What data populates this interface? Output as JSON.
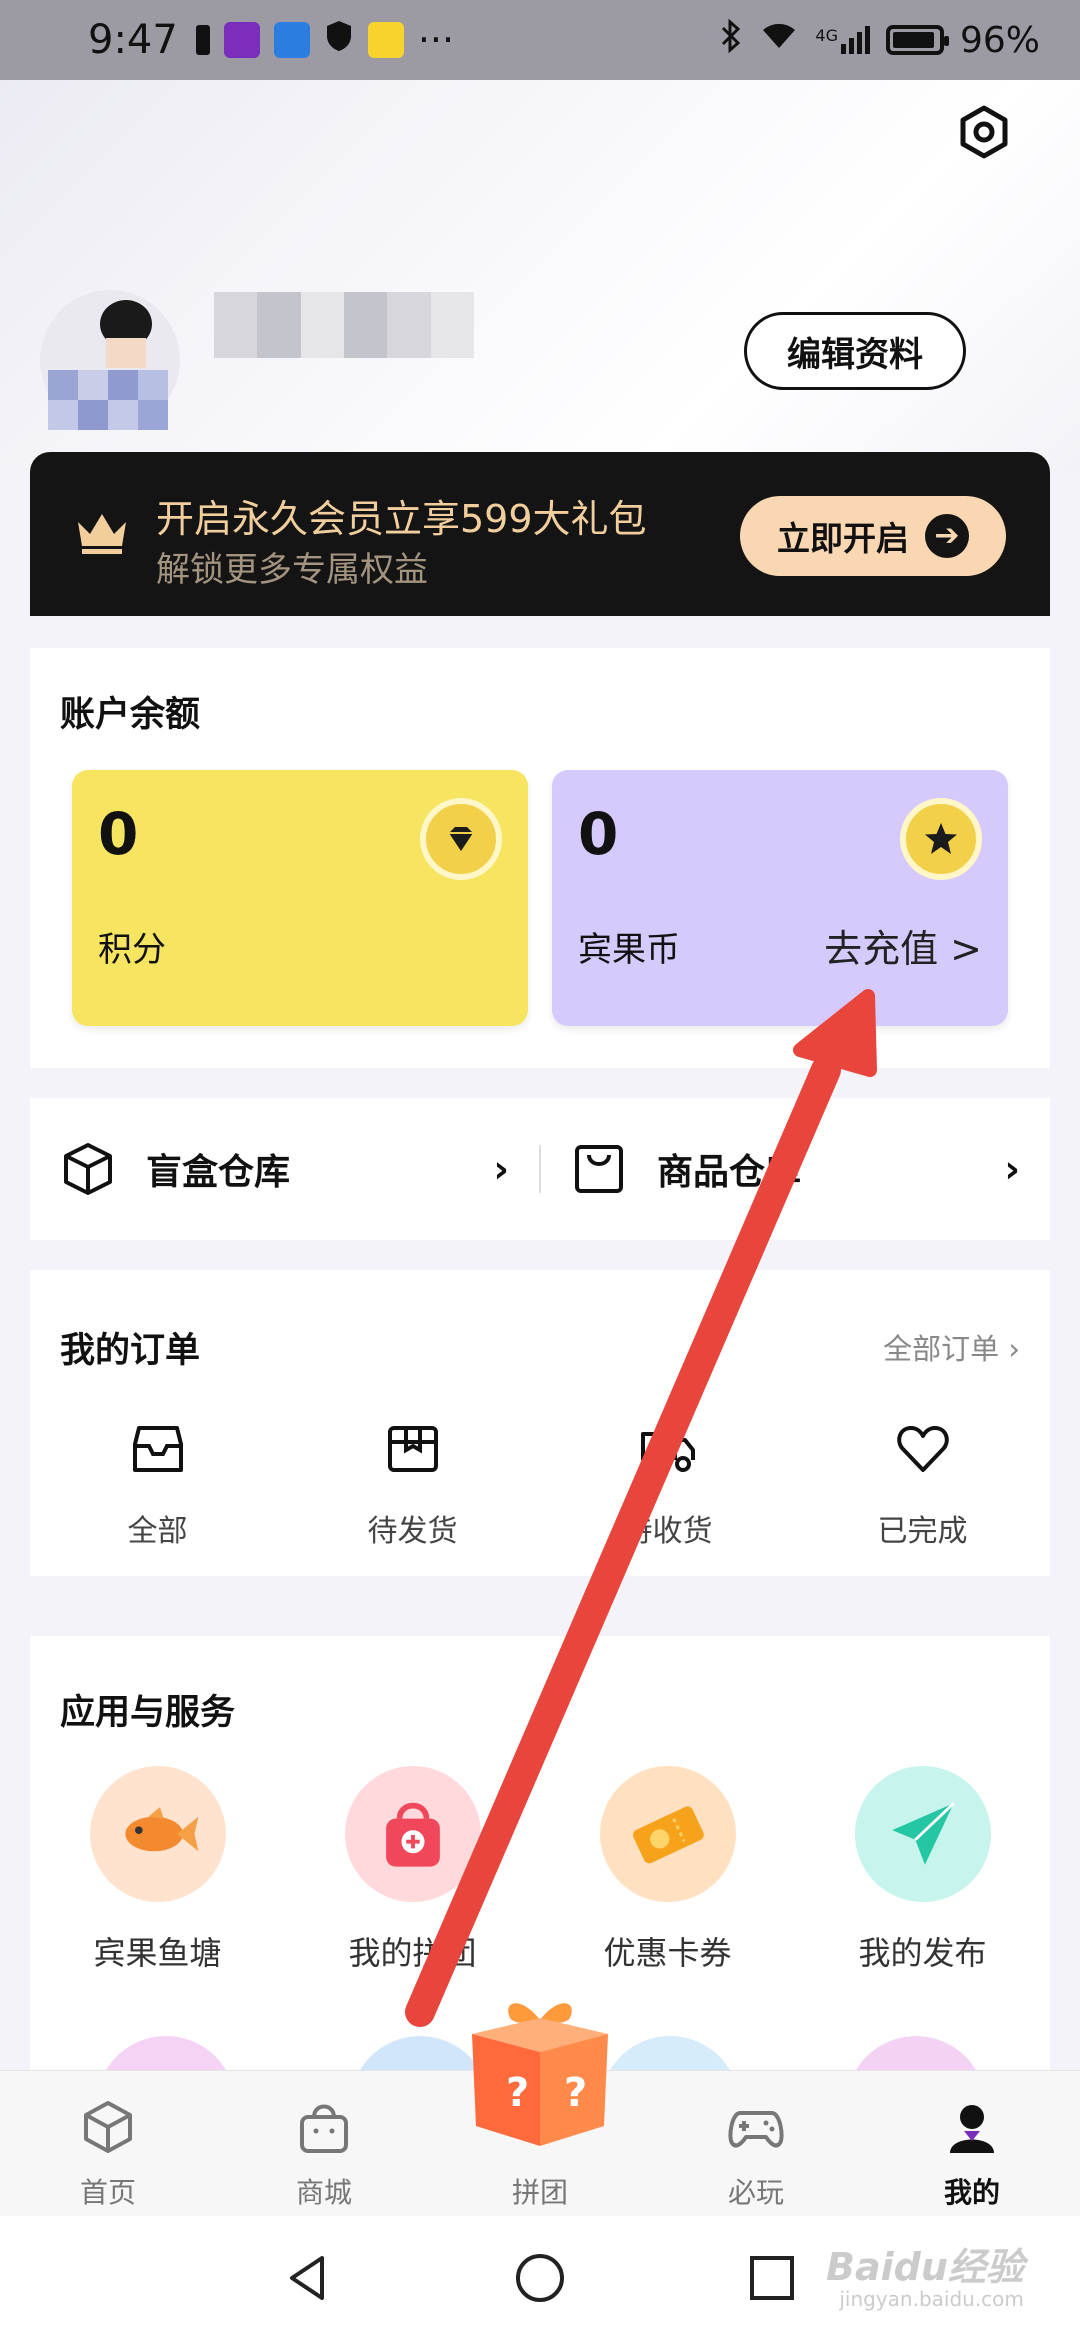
{
  "status_bar": {
    "time": "9:47",
    "battery": "96%",
    "network": "4G",
    "icons": [
      "battery-saver-icon",
      "app-notification-icon",
      "message-icon",
      "shield-icon",
      "app-notification-icon",
      "more-dots-icon",
      "bluetooth-icon",
      "wifi-icon",
      "signal-icon",
      "battery-icon"
    ]
  },
  "header": {
    "edit_profile_label": "编辑资料"
  },
  "vip_banner": {
    "title": "开启永久会员立享599大礼包",
    "subtitle": "解锁更多专属权益",
    "button_label": "立即开启",
    "colors": {
      "background": "#141414",
      "title": "#f2ce9c",
      "button": "#f9d7b3"
    }
  },
  "balance": {
    "title": "账户余额",
    "points": {
      "value": "0",
      "label": "积分",
      "color": "#f7e561"
    },
    "coins": {
      "value": "0",
      "label": "宾果币",
      "recharge_label": "去充值 >",
      "color": "#d6cafd"
    }
  },
  "warehouse": {
    "items": [
      {
        "label": "盲盒仓库",
        "icon": "box-icon"
      },
      {
        "label": "商品仓库",
        "icon": "bag-icon"
      }
    ]
  },
  "orders": {
    "title": "我的订单",
    "all_link": "全部订单 ›",
    "items": [
      {
        "label": "全部",
        "icon": "inbox-icon"
      },
      {
        "label": "待发货",
        "icon": "package-icon"
      },
      {
        "label": "待收货",
        "icon": "truck-icon"
      },
      {
        "label": "已完成",
        "icon": "heart-icon"
      }
    ]
  },
  "services": {
    "title": "应用与服务",
    "items": [
      {
        "label": "宾果鱼塘",
        "icon": "fish-icon"
      },
      {
        "label": "我的拼团",
        "icon": "group-bag-icon"
      },
      {
        "label": "优惠卡券",
        "icon": "coupon-icon"
      },
      {
        "label": "我的发布",
        "icon": "paper-plane-icon"
      }
    ]
  },
  "bottom_nav": {
    "items": [
      {
        "label": "首页",
        "icon": "home-cube-icon"
      },
      {
        "label": "商城",
        "icon": "shop-bag-icon"
      },
      {
        "label": "拼团",
        "icon": "gift-box-icon"
      },
      {
        "label": "必玩",
        "icon": "gamepad-icon"
      },
      {
        "label": "我的",
        "icon": "profile-icon"
      }
    ],
    "active": "我的"
  },
  "watermark": {
    "brand": "Baidu经验",
    "url": "jingyan.baidu.com"
  },
  "annotation": {
    "type": "red-arrow",
    "color": "#e8453c"
  }
}
